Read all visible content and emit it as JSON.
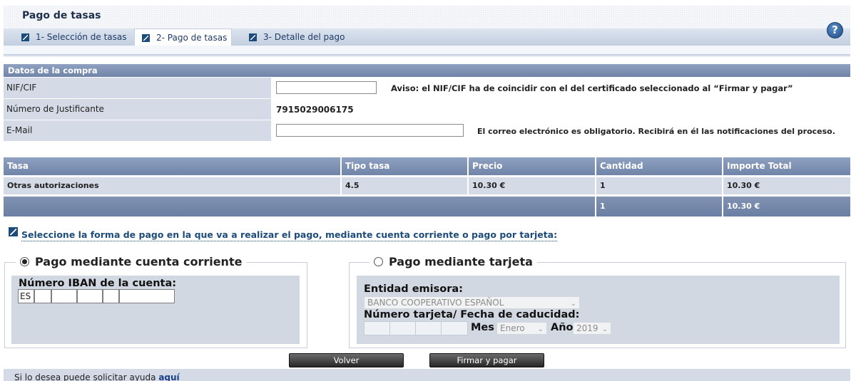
{
  "header": {
    "title": "Pago de tasas",
    "tabs": [
      {
        "label": "1- Selección de tasas"
      },
      {
        "label": "2- Pago de tasas"
      },
      {
        "label": "3- Detalle del pago"
      }
    ],
    "help_icon": "?"
  },
  "purchase": {
    "section_title": "Datos de la compra",
    "nif_label": "NIF/CIF",
    "nif_value": "",
    "nif_notice": "Aviso: el NIF/CIF ha de coincidir con el del certificado seleccionado al “Firmar y pagar”",
    "justificante_label": "Número de Justificante",
    "justificante_value": "7915029006175",
    "email_label": "E-Mail",
    "email_value": "",
    "email_notice": "El correo electrónico es obligatorio. Recibirá en él las notificaciones del proceso."
  },
  "fees_table": {
    "headers": [
      "Tasa",
      "Tipo tasa",
      "Precio",
      "Cantidad",
      "Importe Total"
    ],
    "row": [
      "Otras autorizaciones",
      "4.5",
      "10.30 €",
      "1",
      "10.30 €"
    ],
    "total_quantity": "1",
    "total_amount": "10.30 €"
  },
  "payment": {
    "prompt": "Seleccione la forma de pago en la que va a realizar el pago, mediante cuenta corriente o pago por tarjeta:",
    "account": {
      "title": "Pago mediante cuenta corriente",
      "selected": true,
      "iban_label": "Número IBAN de la cuenta:",
      "iban_prefix": "ES"
    },
    "card": {
      "title": "Pago mediante tarjeta",
      "selected": false,
      "issuer_label": "Entidad emisora:",
      "issuer_value": "BANCO COOPERATIVO ESPAÑOL",
      "card_label": "Número tarjeta/ Fecha de caducidad:",
      "month_label": "Mes",
      "month_value": "Enero",
      "year_label": "Año",
      "year_value": "2019"
    }
  },
  "buttons": {
    "back": "Volver",
    "sign_pay": "Firmar y pagar"
  },
  "footer": {
    "text": "Si lo desea puede solicitar ayuda ",
    "link": "aquí"
  }
}
